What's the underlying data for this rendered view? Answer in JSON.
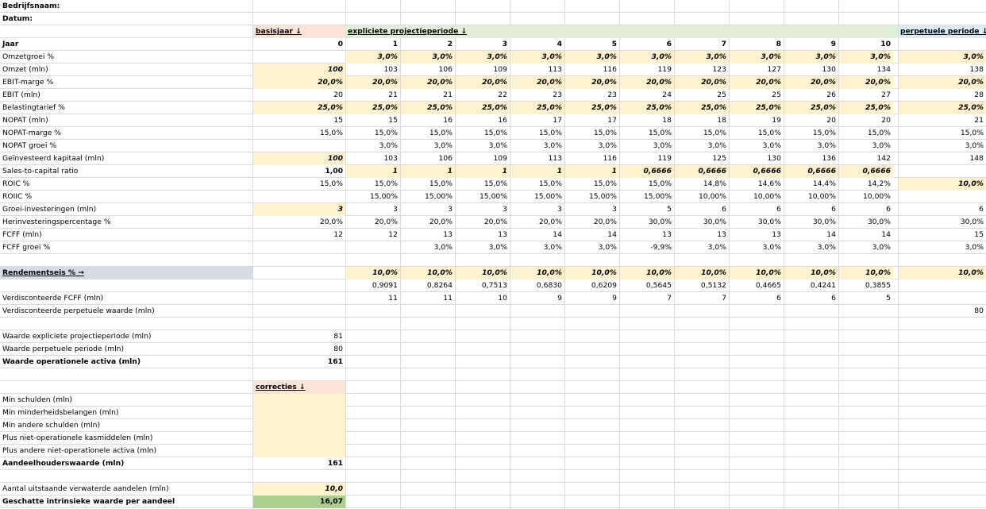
{
  "colors": {
    "input": "#fff2cc",
    "header_base": "#fce4d6",
    "header_explicit": "#e2efda",
    "header_perp": "#ddebf7",
    "discount_label_bg": "#d6dce4",
    "result_bg": "#a9d08e"
  },
  "top": {
    "company": "Bedrijfsnaam:",
    "date": "Datum:"
  },
  "headers": {
    "base": "basisjaar ↓",
    "explicit": "expliciete projectieperiode ↓",
    "perpetual": "perpetuele periode ↓"
  },
  "year": {
    "label": "Jaar",
    "base": "0",
    "years": [
      "1",
      "2",
      "3",
      "4",
      "5",
      "6",
      "7",
      "8",
      "9",
      "10"
    ]
  },
  "rows": {
    "revenue_growth": {
      "label": "Omzetgroei %",
      "years": [
        "3,0%",
        "3,0%",
        "3,0%",
        "3,0%",
        "3,0%",
        "3,0%",
        "3,0%",
        "3,0%",
        "3,0%",
        "3,0%"
      ],
      "perp": "3,0%"
    },
    "revenue": {
      "label": "Omzet (mln)",
      "base": "100",
      "years": [
        "103",
        "106",
        "109",
        "113",
        "116",
        "119",
        "123",
        "127",
        "130",
        "134"
      ],
      "perp": "138"
    },
    "ebit_margin": {
      "label": "EBIT-marge %",
      "base": "20,0%",
      "years": [
        "20,0%",
        "20,0%",
        "20,0%",
        "20,0%",
        "20,0%",
        "20,0%",
        "20,0%",
        "20,0%",
        "20,0%",
        "20,0%"
      ],
      "perp": "20,0%"
    },
    "ebit": {
      "label": "EBIT (mln)",
      "base": "20",
      "years": [
        "21",
        "21",
        "22",
        "23",
        "23",
        "24",
        "25",
        "25",
        "26",
        "27"
      ],
      "perp": "28"
    },
    "tax_rate": {
      "label": "Belastingtarief %",
      "base": "25,0%",
      "years": [
        "25,0%",
        "25,0%",
        "25,0%",
        "25,0%",
        "25,0%",
        "25,0%",
        "25,0%",
        "25,0%",
        "25,0%",
        "25,0%"
      ],
      "perp": "25,0%"
    },
    "nopat": {
      "label": "NOPAT (mln)",
      "base": "15",
      "years": [
        "15",
        "16",
        "16",
        "17",
        "17",
        "18",
        "18",
        "19",
        "20",
        "20"
      ],
      "perp": "21"
    },
    "nopat_margin": {
      "label": "NOPAT-marge %",
      "base": "15,0%",
      "years": [
        "15,0%",
        "15,0%",
        "15,0%",
        "15,0%",
        "15,0%",
        "15,0%",
        "15,0%",
        "15,0%",
        "15,0%",
        "15,0%"
      ],
      "perp": "15,0%"
    },
    "nopat_growth": {
      "label": "NOPAT groei %",
      "years": [
        "3,0%",
        "3,0%",
        "3,0%",
        "3,0%",
        "3,0%",
        "3,0%",
        "3,0%",
        "3,0%",
        "3,0%",
        "3,0%"
      ],
      "perp": "3,0%"
    },
    "invested_capital": {
      "label": "Geïnvesteerd kapitaal (mln)",
      "base": "100",
      "years": [
        "103",
        "106",
        "109",
        "113",
        "116",
        "119",
        "125",
        "130",
        "136",
        "142"
      ],
      "perp": "148"
    },
    "sales_to_capital": {
      "label": "Sales-to-capital ratio",
      "base": "1,00",
      "years": [
        "1",
        "1",
        "1",
        "1",
        "1",
        "0,6666",
        "0,6666",
        "0,6666",
        "0,6666",
        "0,6666"
      ]
    },
    "roic": {
      "label": "ROIC %",
      "base": "15,0%",
      "years": [
        "15,0%",
        "15,0%",
        "15,0%",
        "15,0%",
        "15,0%",
        "15,0%",
        "14,8%",
        "14,6%",
        "14,4%",
        "14,2%"
      ],
      "perp": "10,0%"
    },
    "roiic": {
      "label": "ROIIC %",
      "years": [
        "15,00%",
        "15,00%",
        "15,00%",
        "15,00%",
        "15,00%",
        "15,00%",
        "10,00%",
        "10,00%",
        "10,00%",
        "10,00%"
      ]
    },
    "growth_investments": {
      "label": "Groei-investeringen (mln)",
      "base": "3",
      "years": [
        "3",
        "3",
        "3",
        "3",
        "3",
        "5",
        "6",
        "6",
        "6",
        "6"
      ],
      "perp": "6"
    },
    "reinvestment_rate": {
      "label": "Herinvesteringspercentage %",
      "base": "20,0%",
      "years": [
        "20,0%",
        "20,0%",
        "20,0%",
        "20,0%",
        "20,0%",
        "30,0%",
        "30,0%",
        "30,0%",
        "30,0%",
        "30,0%"
      ],
      "perp": "30,0%"
    },
    "fcff": {
      "label": "FCFF (mln)",
      "base": "12",
      "years": [
        "12",
        "13",
        "13",
        "14",
        "14",
        "13",
        "13",
        "13",
        "14",
        "14"
      ],
      "perp": "15"
    },
    "fcff_growth": {
      "label": "FCFF groei %",
      "years": [
        "",
        "3,0%",
        "3,0%",
        "3,0%",
        "3,0%",
        "-9,9%",
        "3,0%",
        "3,0%",
        "3,0%",
        "3,0%"
      ],
      "perp": "3,0%"
    }
  },
  "discount": {
    "label": "Rendementseis % →",
    "rates": [
      "10,0%",
      "10,0%",
      "10,0%",
      "10,0%",
      "10,0%",
      "10,0%",
      "10,0%",
      "10,0%",
      "10,0%",
      "10,0%"
    ],
    "perp": "10,0%",
    "factors": [
      "0,9091",
      "0,8264",
      "0,7513",
      "0,6830",
      "0,6209",
      "0,5645",
      "0,5132",
      "0,4665",
      "0,4241",
      "0,3855"
    ],
    "pv_fcff": {
      "label": "Verdisconteerde FCFF (mln)",
      "years": [
        "11",
        "11",
        "10",
        "9",
        "9",
        "7",
        "7",
        "6",
        "6",
        "5"
      ]
    },
    "pv_terminal": {
      "label": "Verdisconteerde perpetuele waarde (mln)",
      "perp": "80"
    }
  },
  "valuation": {
    "explicit": {
      "label": "Waarde expliciete projectieperiode (mln)",
      "value": "81"
    },
    "perpetual": {
      "label": "Waarde perpetuele periode (mln)",
      "value": "80"
    },
    "operating": {
      "label": "Waarde operationele activa (mln)",
      "value": "161"
    }
  },
  "corrections": {
    "header": "correcties ↓",
    "items": [
      "Min schulden (mln)",
      "Min minderheidsbelangen (mln)",
      "Min andere schulden (mln)",
      "Plus niet-operationele kasmiddelen (mln)",
      "Plus andere niet-operationele activa (mln)"
    ],
    "equity": {
      "label": "Aandeelhouderswaarde (mln)",
      "value": "161"
    }
  },
  "shares": {
    "label": "Aantal uitstaande verwaterde aandelen (mln)",
    "value": "10,0"
  },
  "intrinsic": {
    "label": "Geschatte intrinsieke waarde per aandeel",
    "value": "16,07"
  }
}
